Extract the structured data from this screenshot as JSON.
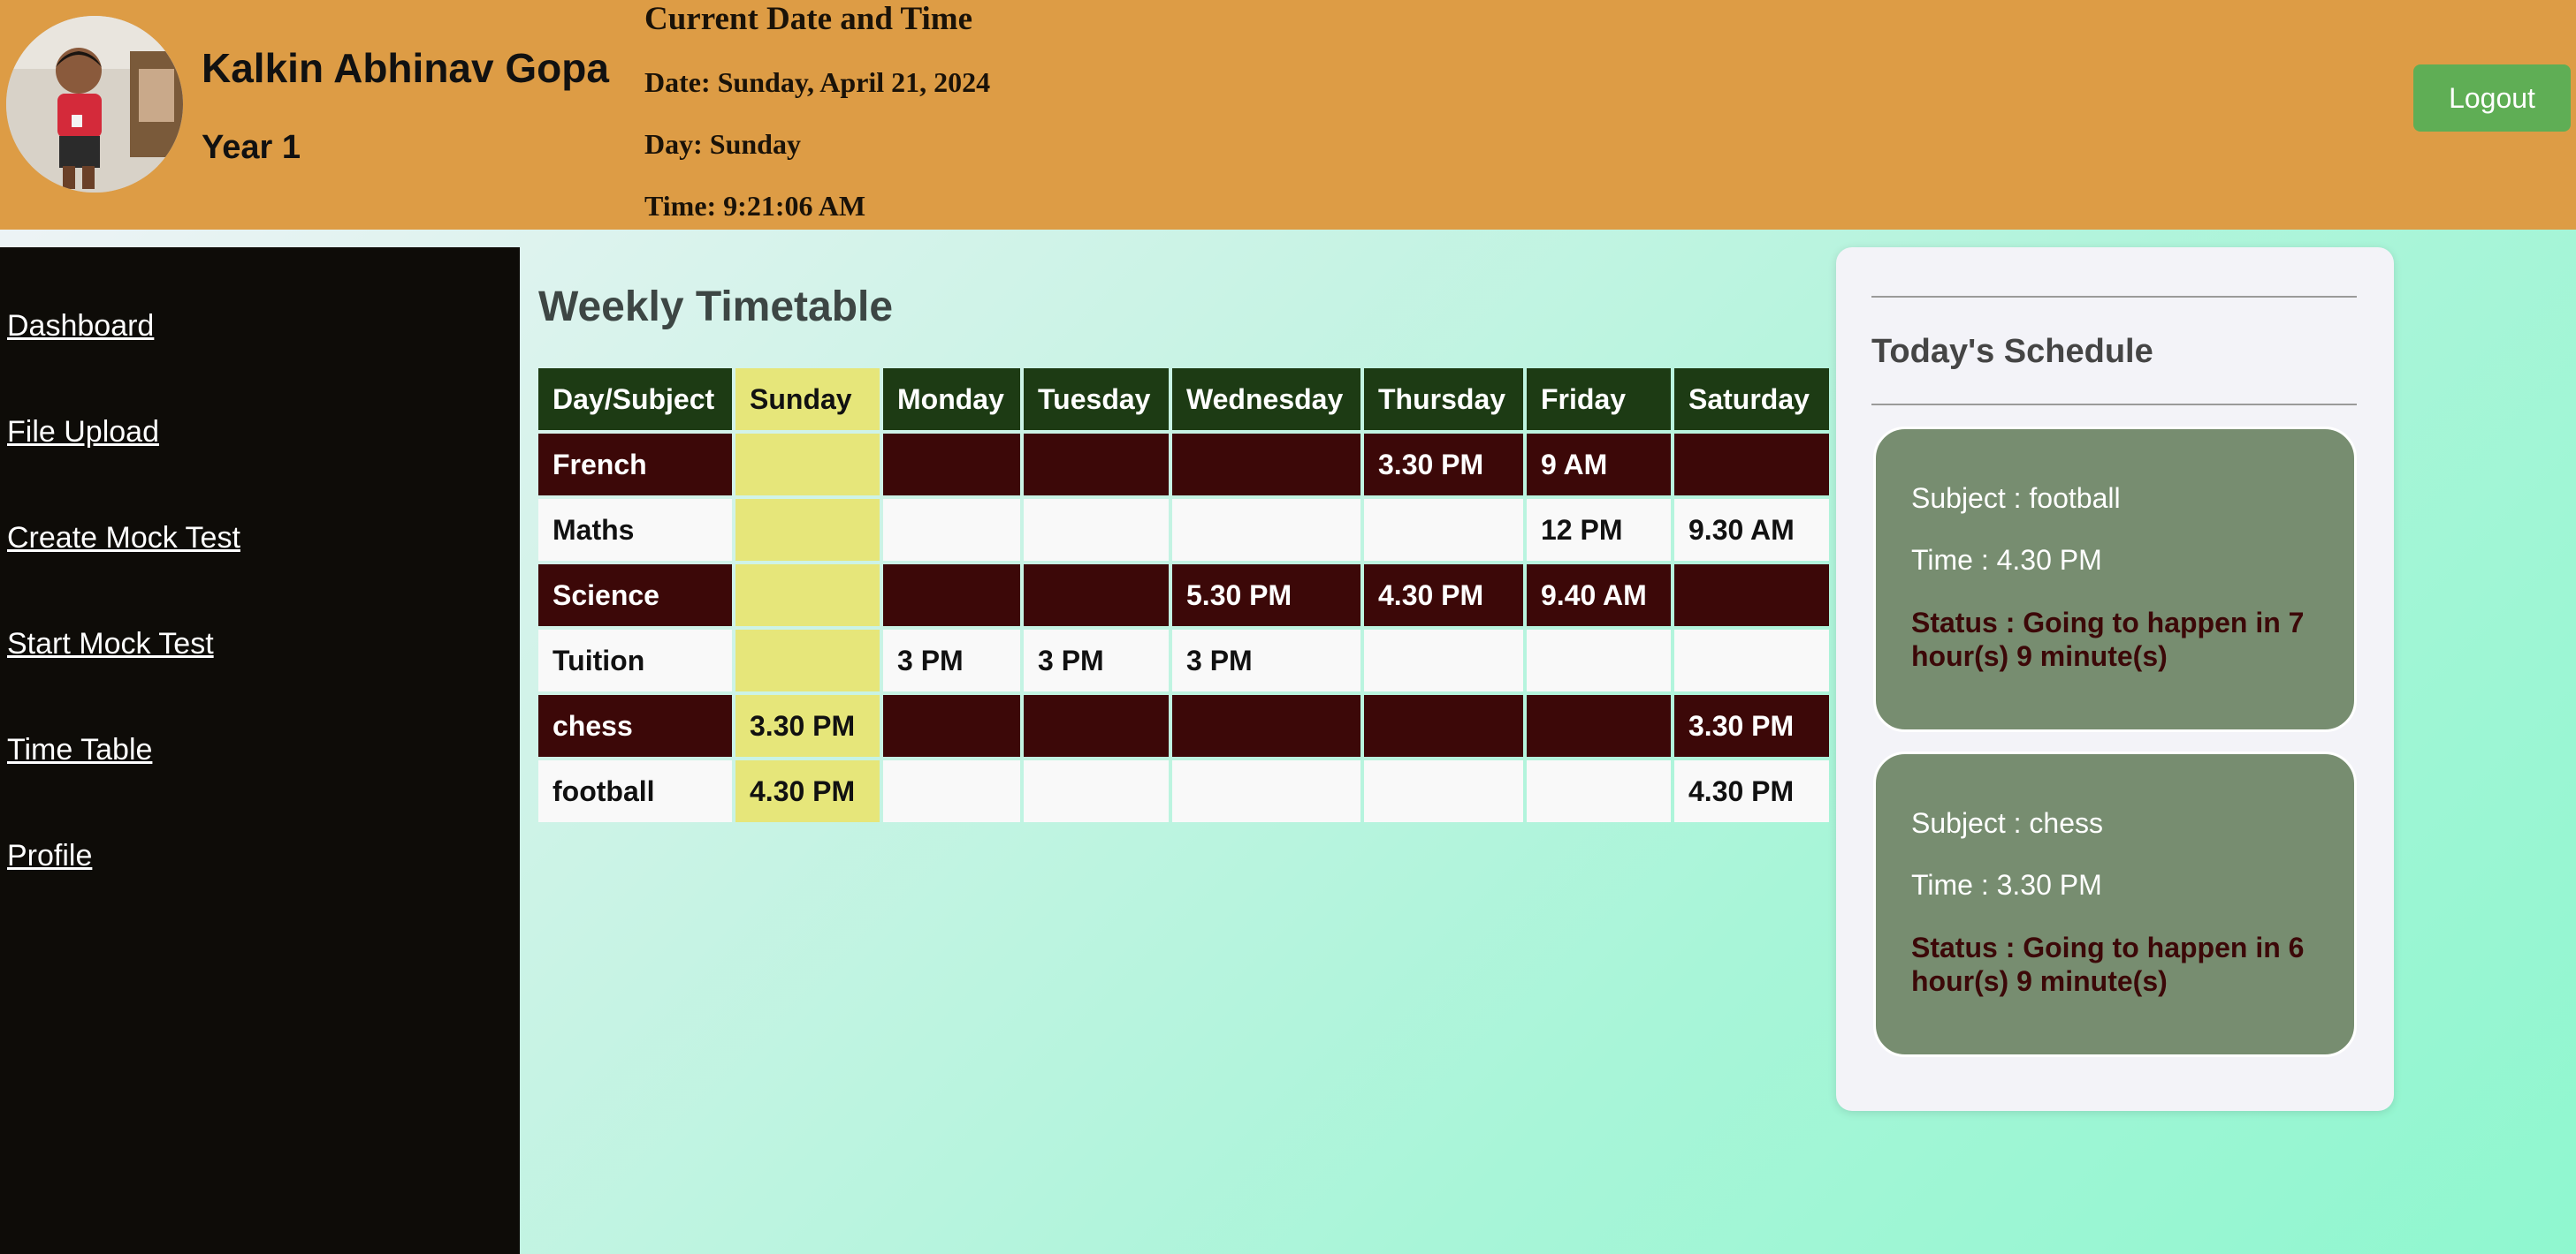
{
  "header": {
    "student_name": "Kalkin Abhinav Gopa",
    "year": "Year 1",
    "datetime_title": "Current Date and Time",
    "date_line": "Date: Sunday, April 21, 2024",
    "day_line": "Day: Sunday",
    "time_line": "Time: 9:21:06 AM",
    "logout_label": "Logout"
  },
  "sidebar": {
    "items": [
      {
        "label": "Dashboard"
      },
      {
        "label": "File Upload"
      },
      {
        "label": "Create Mock Test"
      },
      {
        "label": "Start Mock Test"
      },
      {
        "label": "Time Table"
      },
      {
        "label": "Profile"
      }
    ]
  },
  "timetable": {
    "title": "Weekly Timetable",
    "headers": [
      "Day/Subject",
      "Sunday",
      "Monday",
      "Tuesday",
      "Wednesday",
      "Thursday",
      "Friday",
      "Saturday"
    ],
    "rows": [
      {
        "subject": "French",
        "cells": [
          "",
          "",
          "",
          "",
          "3.30 PM",
          "9 AM",
          ""
        ]
      },
      {
        "subject": "Maths",
        "cells": [
          "",
          "",
          "",
          "",
          "",
          "12 PM",
          "9.30 AM"
        ]
      },
      {
        "subject": "Science",
        "cells": [
          "",
          "",
          "",
          "5.30 PM",
          "4.30 PM",
          "9.40 AM",
          ""
        ]
      },
      {
        "subject": "Tuition",
        "cells": [
          "",
          "3 PM",
          "3 PM",
          "3 PM",
          "",
          "",
          ""
        ]
      },
      {
        "subject": "chess",
        "cells": [
          "3.30 PM",
          "",
          "",
          "",
          "",
          "",
          "3.30 PM"
        ]
      },
      {
        "subject": "football",
        "cells": [
          "4.30 PM",
          "",
          "",
          "",
          "",
          "",
          "4.30 PM"
        ]
      }
    ]
  },
  "schedule": {
    "title": "Today's Schedule",
    "items": [
      {
        "subject": "Subject : football",
        "time": "Time : 4.30 PM",
        "status": "Status : Going to happen in 7 hour(s) 9 minute(s)"
      },
      {
        "subject": "Subject : chess",
        "time": "Time : 3.30 PM",
        "status": "Status : Going to happen in 6 hour(s) 9 minute(s)"
      }
    ]
  },
  "colors": {
    "header_bg": "#dd9c45",
    "sidebar_bg": "#0e0c08",
    "table_header_bg": "#1d3b14",
    "today_column_bg": "#e6e67a",
    "dark_row_bg": "#3c0808",
    "card_bg": "#778d70",
    "logout_bg": "#5fae55"
  }
}
